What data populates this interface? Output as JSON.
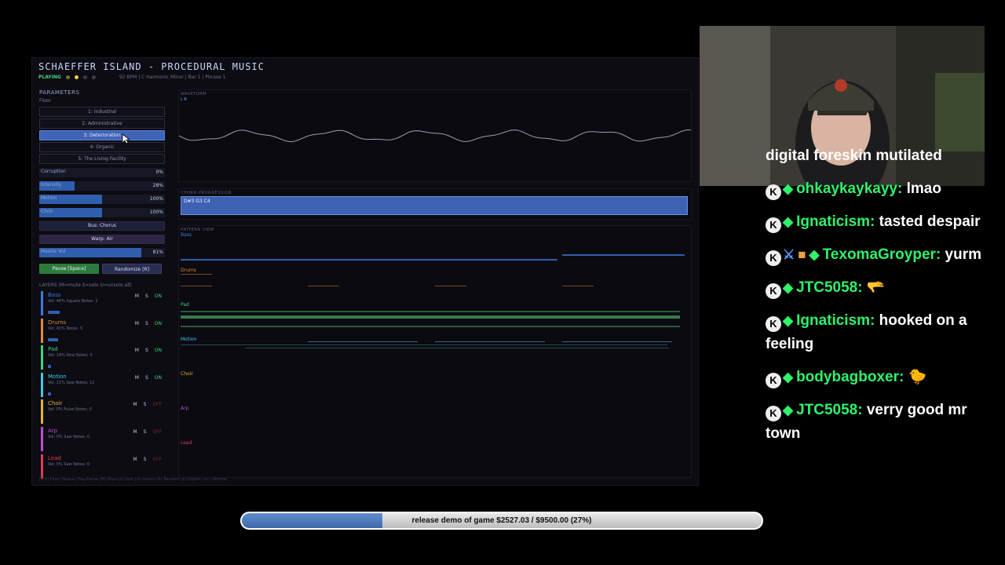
{
  "app": {
    "title": "SCHAEFFER ISLAND - PROCEDURAL MUSIC",
    "status": "PLAYING",
    "meta": "92 BPM  |  C Harmonic Minor  |  Bar 1  |  Phrase 1",
    "parameters_heading": "PARAMETERS",
    "floor_heading": "Floor",
    "floors": [
      "1: Industrial",
      "2: Administrative",
      "3: Deterioration",
      "4: Organic",
      "5: The Living Facility"
    ],
    "active_floor_index": 2,
    "sliders": [
      {
        "label": "Corruption",
        "value": "0%",
        "level": 0
      },
      {
        "label": "Intensity",
        "value": "28%",
        "level": 0.28
      },
      {
        "label": "Motion",
        "value": "100%",
        "level": 0.5
      },
      {
        "label": "Choir",
        "value": "100%",
        "level": 0.5
      }
    ],
    "bus_button": "Bus: Chorus",
    "warp_button": "Warp: Air",
    "master": {
      "label": "Master Vol",
      "value": "81%",
      "level": 0.81
    },
    "pause_button": "Pause [Space]",
    "randomize_button": "Randomize [R]",
    "layers_heading": "LAYERS  (M=mute  S=solo  U=unsolo all)",
    "layers": [
      {
        "name": "Bass",
        "info": "Vol: 46%  Square  Notes: 2",
        "color": "#3f78e0",
        "state": "ON",
        "level": 0.46
      },
      {
        "name": "Drums",
        "info": "Vol: 41%  Notes: 5",
        "color": "#e08a3a",
        "state": "ON",
        "level": 0.41
      },
      {
        "name": "Pad",
        "info": "Vol: 14%  Sine  Notes: 5",
        "color": "#3fd27a",
        "state": "ON",
        "level": 0.14
      },
      {
        "name": "Motion",
        "info": "Vol: 11%  Saw  Notes: 11",
        "color": "#3fc8e0",
        "state": "ON",
        "level": 0.11
      },
      {
        "name": "Choir",
        "info": "Vol: 0%  Pulse  Notes: 0",
        "color": "#e0b43a",
        "state": "OFF",
        "level": 0
      },
      {
        "name": "Arp",
        "info": "Vol: 0%  Saw  Notes: 0",
        "color": "#c04ad8",
        "state": "OFF",
        "level": 0
      },
      {
        "name": "Lead",
        "info": "Vol: 0%  Saw  Notes: 0",
        "color": "#e03a5a",
        "state": "OFF",
        "level": 0
      }
    ],
    "mute_label": "M",
    "solo_label": "S",
    "help": "[1-5] Floor  [Space] Play/Pause  [M] Mute  [S] Solo  [U] Unsolo  [R] Random  [E] Export  [+/-] Volume",
    "waveform_heading": "WAVEFORM",
    "waveform_channels": "L  R",
    "chord_heading": "CHORD PROGRESSION",
    "chord_text": "D#3 G3 C4",
    "pattern_heading": "PATTERN VIEW",
    "pattern_tracks": [
      "Bass",
      "Drums",
      "Pad",
      "Motion",
      "Choir",
      "Arp",
      "Lead"
    ]
  },
  "chat": [
    {
      "user": "",
      "text": "digital foreskin mutilated"
    },
    {
      "user": "ohkaykaykayy:",
      "text": "lmao"
    },
    {
      "user": "Ignaticism:",
      "text": "tasted despair"
    },
    {
      "user": "TexomaGroyper:",
      "text": "yurm"
    },
    {
      "user": "JTC5058:",
      "text": "🫳"
    },
    {
      "user": "Ignaticism:",
      "text": "hooked on a feeling"
    },
    {
      "user": "bodybagboxer:",
      "text": "🐤"
    },
    {
      "user": "JTC5058:",
      "text": "verry good mr town"
    }
  ],
  "goal": {
    "text": "release demo of game $2527.03 / $9500.00 (27%)",
    "progress": 0.27
  }
}
